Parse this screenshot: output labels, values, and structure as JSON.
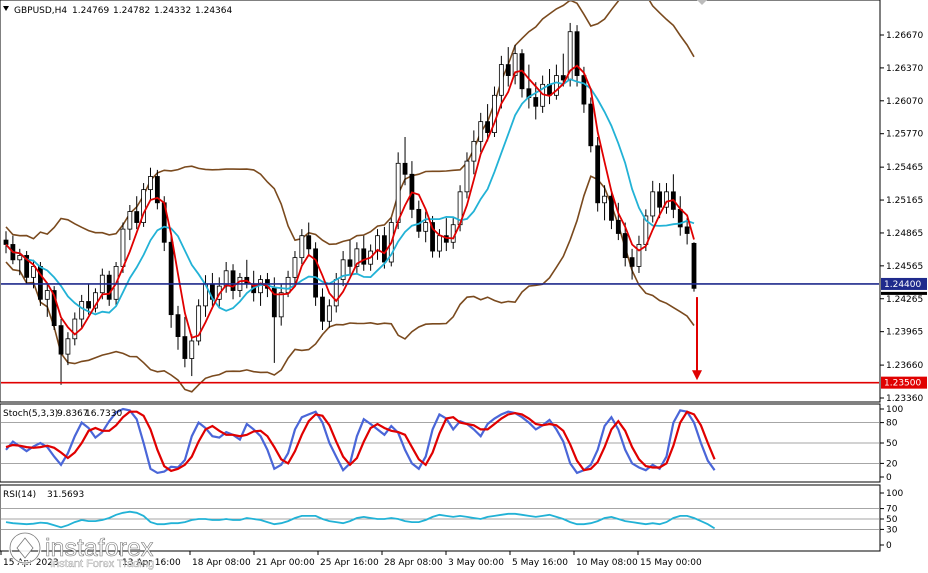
{
  "chart_data": {
    "type": "candlestick",
    "main": {
      "symbol": "GBPUSD,H4",
      "ohlc_readout": [
        "1.24769",
        "1.24782",
        "1.24332",
        "1.24364"
      ],
      "yticks": [
        "1.26670",
        "1.26370",
        "1.26070",
        "1.25770",
        "1.25465",
        "1.25165",
        "1.24865",
        "1.24565",
        "1.24265",
        "1.23965",
        "1.23660",
        "1.23360"
      ],
      "ylim": [
        1.2325,
        1.2708
      ],
      "levels": [
        {
          "label": "1.24400",
          "value": 1.244,
          "color": "#1f2a8c"
        },
        {
          "label": "1.23500",
          "value": 1.235,
          "color": "#e00000"
        }
      ],
      "current_price": "1.24364",
      "arrow": {
        "from": 1.2428,
        "to": 1.2354,
        "color": "#e00000"
      },
      "candles": [
        [
          1.248,
          1.2488,
          1.2468,
          1.2476
        ],
        [
          1.2476,
          1.2484,
          1.2458,
          1.2462
        ],
        [
          1.2462,
          1.2472,
          1.2448,
          1.2466
        ],
        [
          1.2466,
          1.247,
          1.244,
          1.2446
        ],
        [
          1.2446,
          1.2462,
          1.2436,
          1.2456
        ],
        [
          1.2456,
          1.246,
          1.242,
          1.2426
        ],
        [
          1.2426,
          1.244,
          1.241,
          1.2434
        ],
        [
          1.2434,
          1.2438,
          1.2398,
          1.2402
        ],
        [
          1.2402,
          1.2408,
          1.2348,
          1.2376
        ],
        [
          1.2376,
          1.2396,
          1.2366,
          1.239
        ],
        [
          1.239,
          1.2414,
          1.2384,
          1.2408
        ],
        [
          1.2408,
          1.243,
          1.24,
          1.2424
        ],
        [
          1.2424,
          1.244,
          1.2412,
          1.2418
        ],
        [
          1.2418,
          1.2436,
          1.2414,
          1.2432
        ],
        [
          1.2432,
          1.2454,
          1.2426,
          1.2448
        ],
        [
          1.2448,
          1.2452,
          1.242,
          1.2426
        ],
        [
          1.2426,
          1.246,
          1.242,
          1.2456
        ],
        [
          1.2456,
          1.2496,
          1.245,
          1.249
        ],
        [
          1.249,
          1.2512,
          1.248,
          1.2506
        ],
        [
          1.2506,
          1.252,
          1.249,
          1.2496
        ],
        [
          1.2496,
          1.2532,
          1.2492,
          1.2526
        ],
        [
          1.2526,
          1.2546,
          1.2516,
          1.2538
        ],
        [
          1.2538,
          1.2544,
          1.2508,
          1.2514
        ],
        [
          1.2514,
          1.252,
          1.247,
          1.2478
        ],
        [
          1.2478,
          1.2486,
          1.24,
          1.2412
        ],
        [
          1.2412,
          1.242,
          1.238,
          1.2392
        ],
        [
          1.2392,
          1.241,
          1.2364,
          1.2372
        ],
        [
          1.2372,
          1.2394,
          1.2356,
          1.2388
        ],
        [
          1.2388,
          1.2426,
          1.2384,
          1.242
        ],
        [
          1.242,
          1.2448,
          1.241,
          1.244
        ],
        [
          1.244,
          1.245,
          1.242,
          1.2426
        ],
        [
          1.2426,
          1.2446,
          1.2418,
          1.2438
        ],
        [
          1.2438,
          1.246,
          1.2432,
          1.2452
        ],
        [
          1.2452,
          1.2458,
          1.2426,
          1.2434
        ],
        [
          1.2434,
          1.245,
          1.2428,
          1.2446
        ],
        [
          1.2446,
          1.2462,
          1.2436,
          1.244
        ],
        [
          1.244,
          1.2452,
          1.2424,
          1.2432
        ],
        [
          1.2432,
          1.2448,
          1.242,
          1.2444
        ],
        [
          1.2444,
          1.245,
          1.2428,
          1.2436
        ],
        [
          1.2436,
          1.2446,
          1.2368,
          1.241
        ],
        [
          1.241,
          1.244,
          1.2402,
          1.2432
        ],
        [
          1.2432,
          1.2452,
          1.2428,
          1.2446
        ],
        [
          1.2446,
          1.247,
          1.244,
          1.2464
        ],
        [
          1.2464,
          1.249,
          1.2458,
          1.2484
        ],
        [
          1.2484,
          1.2496,
          1.2466,
          1.2472
        ],
        [
          1.2472,
          1.2478,
          1.242,
          1.2428
        ],
        [
          1.2428,
          1.2436,
          1.2398,
          1.2406
        ],
        [
          1.2406,
          1.2426,
          1.24,
          1.242
        ],
        [
          1.242,
          1.245,
          1.2414,
          1.2444
        ],
        [
          1.2444,
          1.247,
          1.2438,
          1.2462
        ],
        [
          1.2462,
          1.248,
          1.2448,
          1.2456
        ],
        [
          1.2456,
          1.2478,
          1.245,
          1.2472
        ],
        [
          1.2472,
          1.2484,
          1.2452,
          1.2458
        ],
        [
          1.2458,
          1.2476,
          1.2452,
          1.247
        ],
        [
          1.247,
          1.249,
          1.2462,
          1.2484
        ],
        [
          1.2484,
          1.2492,
          1.2454,
          1.246
        ],
        [
          1.246,
          1.25,
          1.2456,
          1.2496
        ],
        [
          1.2496,
          1.256,
          1.249,
          1.255
        ],
        [
          1.255,
          1.2574,
          1.253,
          1.254
        ],
        [
          1.254,
          1.2552,
          1.25,
          1.2508
        ],
        [
          1.2508,
          1.2516,
          1.2482,
          1.2488
        ],
        [
          1.2488,
          1.2506,
          1.2478,
          1.2496
        ],
        [
          1.2496,
          1.2502,
          1.2464,
          1.247
        ],
        [
          1.247,
          1.249,
          1.2464,
          1.2484
        ],
        [
          1.2484,
          1.25,
          1.247,
          1.2478
        ],
        [
          1.2478,
          1.25,
          1.2472,
          1.2494
        ],
        [
          1.2494,
          1.253,
          1.2488,
          1.2524
        ],
        [
          1.2524,
          1.256,
          1.2518,
          1.2552
        ],
        [
          1.2552,
          1.258,
          1.254,
          1.257
        ],
        [
          1.257,
          1.2596,
          1.256,
          1.2588
        ],
        [
          1.2588,
          1.2604,
          1.257,
          1.2578
        ],
        [
          1.2578,
          1.262,
          1.2574,
          1.2612
        ],
        [
          1.2612,
          1.2648,
          1.26,
          1.264
        ],
        [
          1.264,
          1.2656,
          1.262,
          1.263
        ],
        [
          1.263,
          1.2658,
          1.2622,
          1.265
        ],
        [
          1.265,
          1.2654,
          1.261,
          1.2618
        ],
        [
          1.2618,
          1.264,
          1.26,
          1.261
        ],
        [
          1.261,
          1.2624,
          1.259,
          1.2602
        ],
        [
          1.2602,
          1.263,
          1.2596,
          1.2622
        ],
        [
          1.2622,
          1.2636,
          1.2604,
          1.2612
        ],
        [
          1.2612,
          1.264,
          1.2608,
          1.263
        ],
        [
          1.263,
          1.265,
          1.262,
          1.2626
        ],
        [
          1.2626,
          1.2678,
          1.262,
          1.267
        ],
        [
          1.267,
          1.2676,
          1.262,
          1.263
        ],
        [
          1.263,
          1.2638,
          1.2596,
          1.2604
        ],
        [
          1.2604,
          1.261,
          1.256,
          1.2566
        ],
        [
          1.2566,
          1.2574,
          1.2506,
          1.2514
        ],
        [
          1.2514,
          1.253,
          1.2498,
          1.252
        ],
        [
          1.252,
          1.2526,
          1.249,
          1.2498
        ],
        [
          1.2498,
          1.2514,
          1.248,
          1.2486
        ],
        [
          1.2486,
          1.2496,
          1.2456,
          1.2464
        ],
        [
          1.2464,
          1.2472,
          1.2444,
          1.2456
        ],
        [
          1.2456,
          1.2484,
          1.245,
          1.2476
        ],
        [
          1.2476,
          1.2508,
          1.247,
          1.2502
        ],
        [
          1.2502,
          1.2534,
          1.2496,
          1.2524
        ],
        [
          1.2524,
          1.2532,
          1.25,
          1.251
        ],
        [
          1.251,
          1.2532,
          1.2504,
          1.2524
        ],
        [
          1.2524,
          1.254,
          1.25,
          1.2508
        ],
        [
          1.2508,
          1.252,
          1.2484,
          1.2492
        ],
        [
          1.2492,
          1.25,
          1.2476,
          1.2486
        ],
        [
          1.2477,
          1.2478,
          1.2433,
          1.2436
        ]
      ]
    },
    "stoch": {
      "label": "Stoch(5,3,3)",
      "values": [
        "9.8367",
        "16.7330"
      ],
      "yticks": [
        "100",
        "80",
        "50",
        "20",
        "0"
      ],
      "levels": [
        80,
        50,
        20
      ],
      "main": [
        40,
        52,
        45,
        38,
        45,
        50,
        44,
        30,
        18,
        35,
        60,
        80,
        72,
        58,
        66,
        82,
        95,
        100,
        98,
        85,
        50,
        12,
        6,
        8,
        15,
        14,
        25,
        60,
        80,
        72,
        60,
        58,
        66,
        62,
        55,
        78,
        70,
        60,
        40,
        12,
        18,
        35,
        70,
        88,
        92,
        96,
        80,
        50,
        30,
        10,
        20,
        60,
        85,
        78,
        70,
        62,
        75,
        65,
        40,
        20,
        12,
        30,
        70,
        92,
        86,
        70,
        82,
        78,
        70,
        60,
        78,
        86,
        92,
        96,
        94,
        88,
        80,
        70,
        76,
        84,
        70,
        52,
        20,
        6,
        10,
        18,
        40,
        75,
        88,
        70,
        40,
        20,
        14,
        10,
        18,
        12,
        30,
        80,
        98,
        96,
        80,
        50,
        24,
        10
      ],
      "signal": [
        44,
        47,
        46,
        44,
        43,
        44,
        46,
        43,
        36,
        28,
        36,
        50,
        68,
        72,
        68,
        68,
        76,
        88,
        96,
        96,
        90,
        70,
        40,
        16,
        9,
        12,
        18,
        30,
        52,
        70,
        75,
        68,
        62,
        62,
        60,
        62,
        67,
        68,
        60,
        44,
        26,
        20,
        38,
        62,
        82,
        92,
        90,
        76,
        52,
        30,
        18,
        28,
        52,
        72,
        78,
        72,
        68,
        66,
        62,
        44,
        26,
        18,
        36,
        64,
        86,
        88,
        80,
        78,
        76,
        70,
        70,
        78,
        86,
        92,
        94,
        92,
        86,
        78,
        76,
        78,
        76,
        68,
        48,
        24,
        10,
        12,
        22,
        44,
        70,
        82,
        68,
        44,
        26,
        16,
        14,
        14,
        20,
        46,
        80,
        96,
        92,
        76,
        50,
        26
      ]
    },
    "rsi": {
      "label": "RSI(14)",
      "value": "31.5693",
      "yticks": [
        "100",
        "70",
        "50",
        "30",
        "0"
      ],
      "levels": [
        70,
        50,
        30
      ],
      "values": [
        44,
        42,
        41,
        40,
        41,
        43,
        42,
        38,
        34,
        38,
        44,
        48,
        46,
        46,
        48,
        52,
        58,
        62,
        64,
        62,
        56,
        44,
        40,
        40,
        42,
        42,
        44,
        48,
        50,
        50,
        48,
        48,
        50,
        48,
        48,
        52,
        50,
        48,
        44,
        40,
        42,
        46,
        52,
        56,
        56,
        56,
        50,
        46,
        44,
        42,
        46,
        52,
        54,
        52,
        50,
        50,
        52,
        50,
        46,
        44,
        44,
        48,
        54,
        58,
        56,
        54,
        56,
        54,
        52,
        50,
        54,
        56,
        58,
        60,
        60,
        58,
        56,
        54,
        56,
        58,
        54,
        50,
        44,
        40,
        40,
        42,
        46,
        52,
        54,
        50,
        46,
        44,
        42,
        40,
        42,
        40,
        44,
        52,
        56,
        56,
        52,
        46,
        40,
        32
      ]
    },
    "xticks": [
      "15 Apr 2023",
      "13 Apr 16:00",
      "18 Apr 08:00",
      "21 Apr 00:00",
      "25 Apr 16:00",
      "28 Apr 08:00",
      "3 May 00:00",
      "5 May 16:00",
      "10 May 08:00",
      "15 May 00:00"
    ]
  },
  "watermark": {
    "brand": "instaforex",
    "tagline": "Instant Forex Trading"
  },
  "colors": {
    "candle_up": "#000000",
    "candle_down": "#000000",
    "bollinger": "#7a4a1e",
    "ma_fast": "#e00000",
    "ma_slow": "#22b2d6",
    "stoch_main": "#4a66d8",
    "stoch_signal": "#e00000",
    "rsi": "#22b2d6",
    "level_line": "#888888"
  }
}
